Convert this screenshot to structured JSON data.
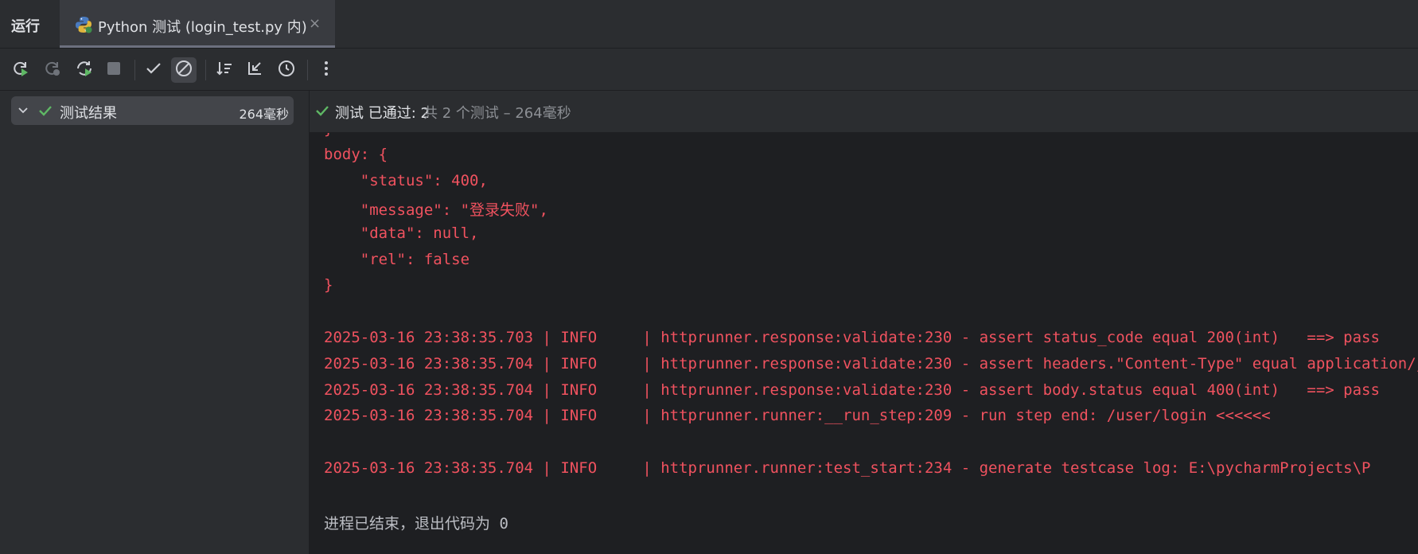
{
  "tool_window": {
    "title": "运行"
  },
  "tab": {
    "icon": "python-icon",
    "label": "Python 测试 (login_test.py 内)",
    "close_glyph": "×"
  },
  "toolbar": {
    "buttons": [
      {
        "name": "rerun-button",
        "icon": "rerun-icon"
      },
      {
        "name": "rerun-failed-button",
        "icon": "rerun-failed-icon"
      },
      {
        "name": "toggle-auto-test-button",
        "icon": "auto-rerun-icon"
      },
      {
        "name": "stop-button",
        "icon": "stop-icon"
      },
      {
        "name": "show-passed-button",
        "icon": "check-icon"
      },
      {
        "name": "show-ignored-button",
        "icon": "ignored-icon",
        "active": true
      },
      {
        "name": "sort-alphabetically-button",
        "icon": "sort-icon"
      },
      {
        "name": "collapse-all-button",
        "icon": "collapse-icon"
      },
      {
        "name": "sort-by-duration-button",
        "icon": "clock-icon"
      },
      {
        "name": "more-options-button",
        "icon": "more-vertical-icon"
      }
    ]
  },
  "tree": {
    "root_label": "测试结果",
    "root_time": "264毫秒"
  },
  "status": {
    "passed_text": "测试 已通过: 2",
    "detail_text": "共 2 个测试 – 264毫秒"
  },
  "console": {
    "lines": [
      "}",
      "body: {",
      "    \"status\": 400,",
      "    \"message\": \"登录失败\",",
      "    \"data\": null,",
      "    \"rel\": false",
      "}",
      "",
      "2025-03-16 23:38:35.703 | INFO     | httprunner.response:validate:230 - assert status_code equal 200(int)   ==> pass",
      "2025-03-16 23:38:35.704 | INFO     | httprunner.response:validate:230 - assert headers.\"Content-Type\" equal application/json",
      "2025-03-16 23:38:35.704 | INFO     | httprunner.response:validate:230 - assert body.status equal 400(int)   ==> pass",
      "2025-03-16 23:38:35.704 | INFO     | httprunner.runner:__run_step:209 - run step end: /user/login <<<<<<",
      "",
      "2025-03-16 23:38:35.704 | INFO     | httprunner.runner:test_start:234 - generate testcase log: E:\\pycharmProjects\\P",
      "",
      "进程已结束，退出代码为 0"
    ]
  },
  "colors": {
    "passed": "#5fb865",
    "log_error": "#f0525f",
    "console_bg": "#1e1f22",
    "panel_bg": "#2b2d30"
  }
}
